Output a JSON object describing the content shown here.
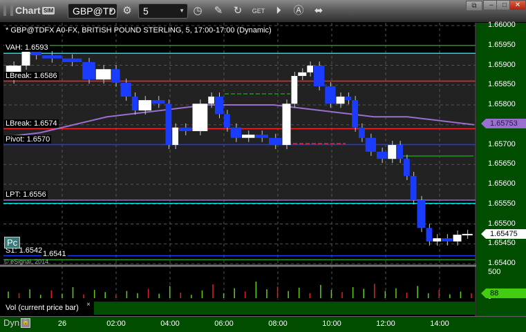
{
  "window": {
    "title": "Chart",
    "sim_badge": "SIM",
    "symbol": "GBP@TD",
    "interval": "5",
    "icons": [
      "gear-icon",
      "clock-icon",
      "pencil-icon",
      "refresh-icon",
      "get-icon",
      "play-icon",
      "alert-icon",
      "link-icon"
    ]
  },
  "chart": {
    "header": "* GBP@TDFX A0-FX, BRITISH POUND STERLING, 5, 17:00-17:00 (Dynamic)",
    "pc_button": "Pc",
    "copyright": "© eSignal, 2014",
    "vol_label": "Vol (current price bar)",
    "vol_close": "×",
    "dyn_label": "Dyn"
  },
  "colors": {
    "up": "#ffffff",
    "down": "#1a3cff",
    "axis_bg": "#004d00",
    "ma": "#9b6fd0"
  },
  "levels": [
    {
      "label": "VAH: 1.6593",
      "price": 1.6593,
      "color": "#00e5e5"
    },
    {
      "label": "",
      "price": 1.6595,
      "color": "#1a9a1a"
    },
    {
      "label": "LBreak: 1.6586",
      "price": 1.6586,
      "color": "#ff2020"
    },
    {
      "label": "LBreak: 1.6574",
      "price": 1.6574,
      "color": "#ff2020"
    },
    {
      "label": "Pivot: 1.6570",
      "price": 1.657,
      "color": "#1a3cff"
    },
    {
      "label": "LPT: 1.6556",
      "price": 1.6556,
      "color": "#9b6fd0"
    },
    {
      "label": "",
      "price": 1.65552,
      "color": "#00e5e5"
    },
    {
      "label": "S1: 1.6542",
      "price": 1.6542,
      "color": "#1a3cff"
    },
    {
      "label": "1.6541",
      "price": 1.6541,
      "color": "#1a9a1a"
    }
  ],
  "price_axis": {
    "ticks": [
      "1.66000",
      "1.65950",
      "1.65900",
      "1.65850",
      "1.65800",
      "1.65750",
      "1.65700",
      "1.65650",
      "1.65600",
      "1.65550",
      "1.65500",
      "1.65450",
      "1.65400"
    ],
    "ma_value": "1.65753",
    "last_price": "1.65475",
    "vol_ticks": [
      "500",
      "0"
    ],
    "vol_value": "88"
  },
  "time_axis": [
    "26",
    "02:00",
    "04:00",
    "06:00",
    "08:00",
    "10:00",
    "12:00",
    "14:00"
  ],
  "chart_data": {
    "type": "candlestick",
    "title": "* GBP@TDFX A0-FX, BRITISH POUND STERLING, 5, 17:00-17:00 (Dynamic)",
    "ylim": [
      1.654,
      1.66
    ],
    "x": [
      "21:55",
      "22:30",
      "22:50",
      "23:15",
      "00:00",
      "00:45",
      "01:15",
      "01:50",
      "02:10",
      "02:35",
      "02:50",
      "03:20",
      "03:50",
      "04:05",
      "04:20",
      "04:50",
      "05:25",
      "05:40",
      "06:00",
      "06:15",
      "06:40",
      "07:10",
      "07:40",
      "08:10",
      "08:30",
      "08:45",
      "09:05",
      "09:20",
      "09:45",
      "10:10",
      "10:30",
      "10:45",
      "11:00",
      "11:15",
      "11:40",
      "12:05",
      "12:25",
      "12:40",
      "12:55",
      "13:10",
      "13:30",
      "13:45",
      "14:05",
      "14:30",
      "14:50",
      "15:15"
    ],
    "close": [
      1.65864,
      1.65899,
      1.65943,
      1.65925,
      1.65917,
      1.65908,
      1.65864,
      1.6589,
      1.65856,
      1.65821,
      1.65786,
      1.65812,
      1.65803,
      1.65699,
      1.65743,
      1.65734,
      1.65803,
      1.65821,
      1.65777,
      1.65743,
      1.65717,
      1.65725,
      1.65717,
      1.65699,
      1.65803,
      1.65873,
      1.65882,
      1.65899,
      1.65847,
      1.65803,
      1.65821,
      1.65812,
      1.65743,
      1.65717,
      1.65682,
      1.65664,
      1.65699,
      1.65664,
      1.65621,
      1.6556,
      1.6549,
      1.65456,
      1.65464,
      1.65456,
      1.65473,
      1.65475
    ],
    "ma": [
      1.6572,
      1.6573,
      1.6575,
      1.6577,
      1.6578,
      1.6579,
      1.658,
      1.658,
      1.658,
      1.6579,
      1.6578,
      1.6577,
      1.6577,
      1.6576,
      1.6575
    ],
    "volume": [
      120,
      90,
      160,
      60,
      140,
      80,
      200,
      70,
      150,
      110,
      60,
      130,
      90,
      170,
      80,
      220,
      100,
      60,
      140,
      250,
      90,
      180,
      120,
      300,
      160,
      210,
      130,
      190,
      90,
      240,
      150,
      110,
      200,
      170,
      260,
      130,
      180,
      100,
      220,
      90,
      150,
      70,
      120,
      88
    ]
  }
}
